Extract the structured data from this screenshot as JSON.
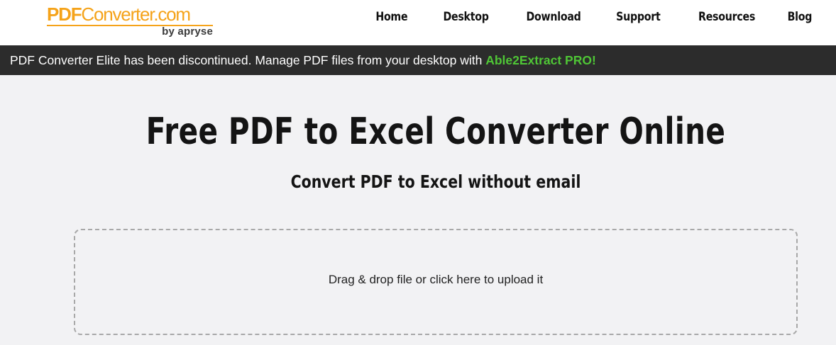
{
  "header": {
    "logo": {
      "pdf": "PDF",
      "converter": "Converter.com",
      "by": "by apryse"
    },
    "nav": [
      "Home",
      "Desktop",
      "Download",
      "Support",
      "Resources",
      "Blog"
    ]
  },
  "banner": {
    "text": "PDF Converter Elite has been discontinued. Manage PDF files from your desktop with ",
    "link": "Able2Extract PRO!"
  },
  "main": {
    "title": "Free PDF to Excel Converter Online",
    "subtitle": "Convert PDF to Excel without email",
    "dropzone_text": "Drag & drop file or click here to upload it"
  },
  "colors": {
    "brand_orange": "#f5a31a",
    "banner_bg": "#2c2c2c",
    "link_green": "#4fc636",
    "page_bg": "#f2f2f4"
  }
}
